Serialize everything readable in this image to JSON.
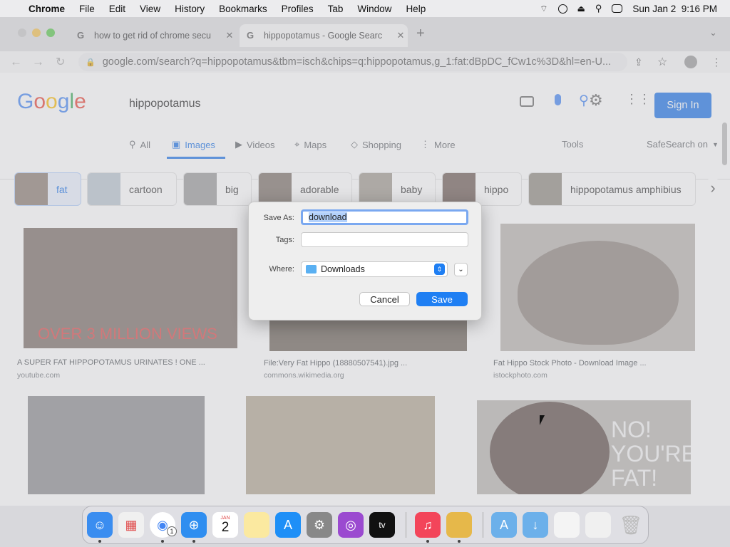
{
  "menubar": {
    "app": "Chrome",
    "items": [
      "File",
      "Edit",
      "View",
      "History",
      "Bookmarks",
      "Profiles",
      "Tab",
      "Window",
      "Help"
    ],
    "clock": "Sun Jan 2  9:16 PM"
  },
  "browser": {
    "tabs": [
      {
        "title": "how to get rid of chrome secu"
      },
      {
        "title": "hippopotamus - Google Searc"
      }
    ],
    "url": "google.com/search?q=hippopotamus&tbm=isch&chips=q:hippopotamus,g_1:fat:dBpDC_fCw1c%3D&hl=en-U..."
  },
  "google": {
    "query": "hippopotamus",
    "signin": "Sign In",
    "nav": [
      "All",
      "Images",
      "Videos",
      "Maps",
      "Shopping",
      "More"
    ],
    "tools": "Tools",
    "safesearch": "SafeSearch on",
    "chips": [
      "fat",
      "cartoon",
      "big",
      "adorable",
      "baby",
      "hippo",
      "hippopotamus amphibius"
    ],
    "results": [
      {
        "caption": "A SUPER FAT HIPPOPOTAMUS URINATES ! ONE ...",
        "source": "youtube.com",
        "overlay_text": "OVER 3 MILLION VIEWS"
      },
      {
        "caption": "File:Very Fat Hippo (18880507541).jpg ...",
        "source": "commons.wikimedia.org"
      },
      {
        "caption": "Fat Hippo Stock Photo - Download Image ...",
        "source": "istockphoto.com"
      }
    ],
    "bottom_overlay_text": [
      "NO!",
      "YOU'RE",
      "FAT!"
    ]
  },
  "dialog": {
    "save_as_label": "Save As:",
    "save_as_value": "download",
    "tags_label": "Tags:",
    "tags_value": "",
    "where_label": "Where:",
    "where_value": "Downloads",
    "cancel": "Cancel",
    "save": "Save"
  },
  "dock": {
    "calendar_month": "JAN",
    "calendar_day": "2",
    "chrome_badge": "1"
  },
  "colors": {
    "accent": "#1a73e8",
    "dialog_save": "#1f7ff3"
  }
}
